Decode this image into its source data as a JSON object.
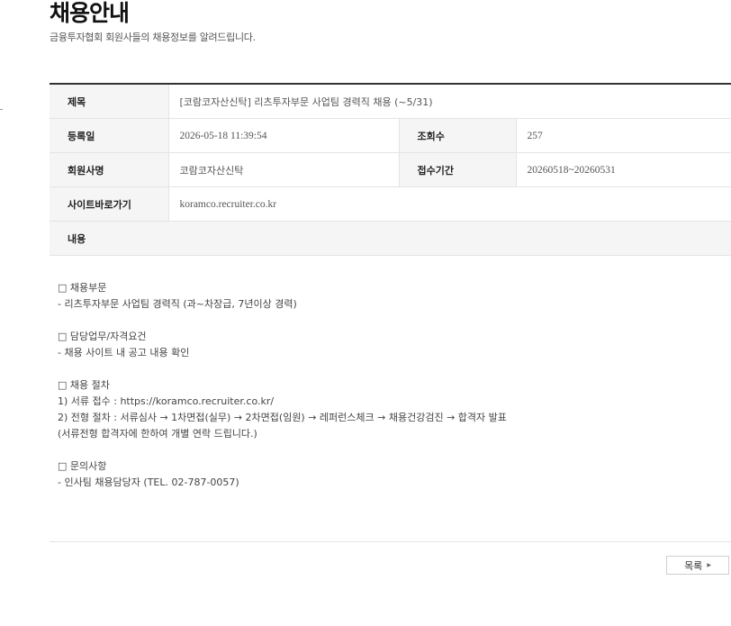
{
  "header": {
    "title": "채용안내",
    "subtitle": "금융투자협회 회원사들의 채용정보를 알려드립니다."
  },
  "detail": {
    "title_label": "제목",
    "title_value": "[코람코자산신탁] 리츠투자부문 사업팀 경력직 채용 (~5/31)",
    "date_label": "등록일",
    "date_value": "2026-05-18 11:39:54",
    "views_label": "조회수",
    "views_value": "257",
    "company_label": "회원사명",
    "company_value": "코람코자산신탁",
    "period_label": "접수기간",
    "period_value": "20260518~20260531",
    "site_label": "사이트바로가기",
    "site_value": "koramco.recruiter.co.kr",
    "content_label": "내용"
  },
  "content": {
    "lines": [
      "□ 채용부문",
      "- 리츠투자부문 사업팀 경력직 (과~차장급, 7년이상 경력)",
      "",
      "□ 담당업무/자격요건",
      "- 채용 사이트 내 공고 내용 확인",
      "",
      "□ 채용 절차",
      "1) 서류 접수 : https://koramco.recruiter.co.kr/",
      "2) 전형 절차 : 서류심사 → 1차면접(실무) → 2차면접(임원) → 레퍼런스체크 → 채용건강검진 → 합격자 발표",
      "(서류전형 합격자에 한하여 개별 연락 드립니다.)",
      "",
      "□ 문의사항",
      "- 인사팀 채용담당자 (TEL. 02-787-0057)"
    ]
  },
  "footer": {
    "list_button": "목록",
    "list_arrow": "▶"
  }
}
